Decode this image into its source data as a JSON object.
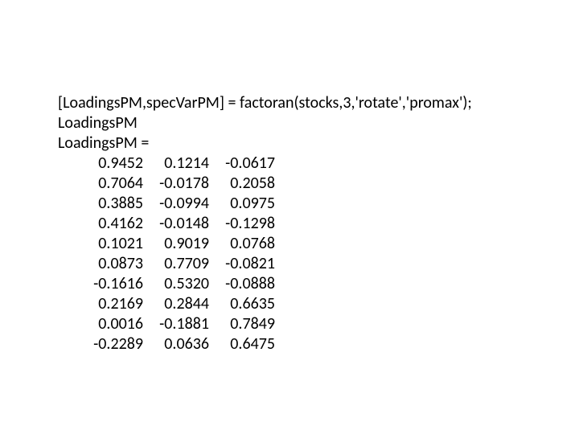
{
  "lines": {
    "command": "[LoadingsPM,specVarPM] = factoran(stocks,3,'rotate','promax');",
    "echo": "LoadingsPM",
    "header": "LoadingsPM ="
  },
  "matrix": [
    [
      "0.9452",
      "0.1214",
      "-0.0617"
    ],
    [
      "0.7064",
      "-0.0178",
      "0.2058"
    ],
    [
      "0.3885",
      "-0.0994",
      "0.0975"
    ],
    [
      "0.4162",
      "-0.0148",
      "-0.1298"
    ],
    [
      "0.1021",
      "0.9019",
      "0.0768"
    ],
    [
      "0.0873",
      "0.7709",
      "-0.0821"
    ],
    [
      "-0.1616",
      "0.5320",
      "-0.0888"
    ],
    [
      "0.2169",
      "0.2844",
      "0.6635"
    ],
    [
      "0.0016",
      "-0.1881",
      "0.7849"
    ],
    [
      "-0.2289",
      "0.0636",
      "0.6475"
    ]
  ]
}
